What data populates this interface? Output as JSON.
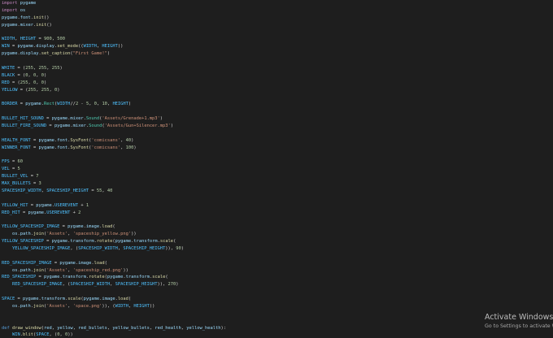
{
  "code_lines": [
    "import pygame",
    "import os",
    "pygame.font.init()",
    "pygame.mixer.init()",
    "",
    "WIDTH, HEIGHT = 900, 500",
    "WIN = pygame.display.set_mode((WIDTH, HEIGHT))",
    "pygame.display.set_caption(\"First Game!\")",
    "",
    "WHITE = (255, 255, 255)",
    "BLACK = (0, 0, 0)",
    "RED = (255, 0, 0)",
    "YELLOW = (255, 255, 0)",
    "",
    "BORDER = pygame.Rect(WIDTH//2 - 5, 0, 10, HEIGHT)",
    "",
    "BULLET_HIT_SOUND = pygame.mixer.Sound('Assets/Grenade+1.mp3')",
    "BULLET_FIRE_SOUND = pygame.mixer.Sound('Assets/Gun+Silencer.mp3')",
    "",
    "HEALTH_FONT = pygame.font.SysFont('comicsans', 40)",
    "WINNER_FONT = pygame.font.SysFont('comicsans', 100)",
    "",
    "FPS = 60",
    "VEL = 5",
    "BULLET_VEL = 7",
    "MAX_BULLETS = 3",
    "SPACESHIP_WIDTH, SPACESHIP_HEIGHT = 55, 40",
    "",
    "YELLOW_HIT = pygame.USEREVENT + 1",
    "RED_HIT = pygame.USEREVENT + 2",
    "",
    "YELLOW_SPACESHIP_IMAGE = pygame.image.load(",
    "    os.path.join('Assets', 'spaceship_yellow.png'))",
    "YELLOW_SPACESHIP = pygame.transform.rotate(pygame.transform.scale(",
    "    YELLOW_SPACESHIP_IMAGE, (SPACESHIP_WIDTH, SPACESHIP_HEIGHT)), 90)",
    "",
    "RED_SPACESHIP_IMAGE = pygame.image.load(",
    "    os.path.join('Assets', 'spaceship_red.png'))",
    "RED_SPACESHIP = pygame.transform.rotate(pygame.transform.scale(",
    "    RED_SPACESHIP_IMAGE, (SPACESHIP_WIDTH, SPACESHIP_HEIGHT)), 270)",
    "",
    "SPACE = pygame.transform.scale(pygame.image.load(",
    "    os.path.join('Assets', 'space.png')), (WIDTH, HEIGHT))",
    "",
    "",
    "def draw_window(red, yellow, red_bullets, yellow_bullets, red_health, yellow_health):",
    "    WIN.blit(SPACE, (0, 0))",
    "    pygame.draw.rect(WIN, BLACK, BORDER)"
  ],
  "watermark": {
    "title": "Activate Windows",
    "subtitle": "Go to Settings to activate Windows."
  },
  "colors": {
    "background": "#1e1e1e",
    "text": "#d4d4d4",
    "keyword": "#c586c0",
    "function": "#dcdcaa",
    "string": "#ce9178",
    "number": "#b5cea8",
    "constant": "#4fc1ff"
  }
}
